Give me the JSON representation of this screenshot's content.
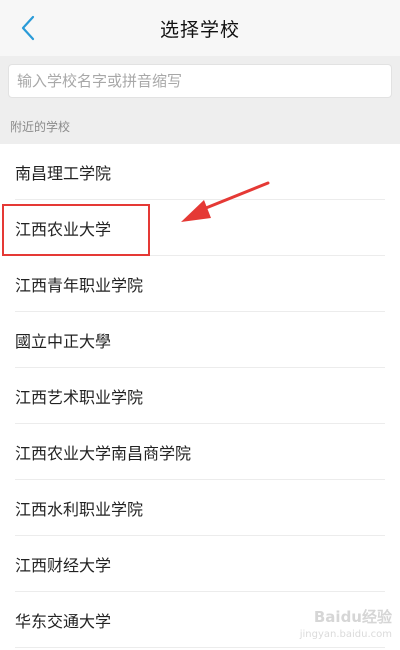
{
  "header": {
    "title": "选择学校",
    "back_icon": "chevron-left-icon",
    "accent_color": "#2a9bd8"
  },
  "search": {
    "placeholder": "输入学校名字或拼音缩写",
    "value": ""
  },
  "section": {
    "label": "附近的学校"
  },
  "schools": [
    "南昌理工学院",
    "江西农业大学",
    "江西青年职业学院",
    "國立中正大學",
    "江西艺术职业学院",
    "江西农业大学南昌商学院",
    "江西水利职业学院",
    "江西财经大学",
    "华东交通大学"
  ],
  "annotation": {
    "highlighted_item": "江西农业大学",
    "color": "#e53935"
  },
  "watermark": {
    "brand": "Baidu经验",
    "url": "jingyan.baidu.com"
  }
}
